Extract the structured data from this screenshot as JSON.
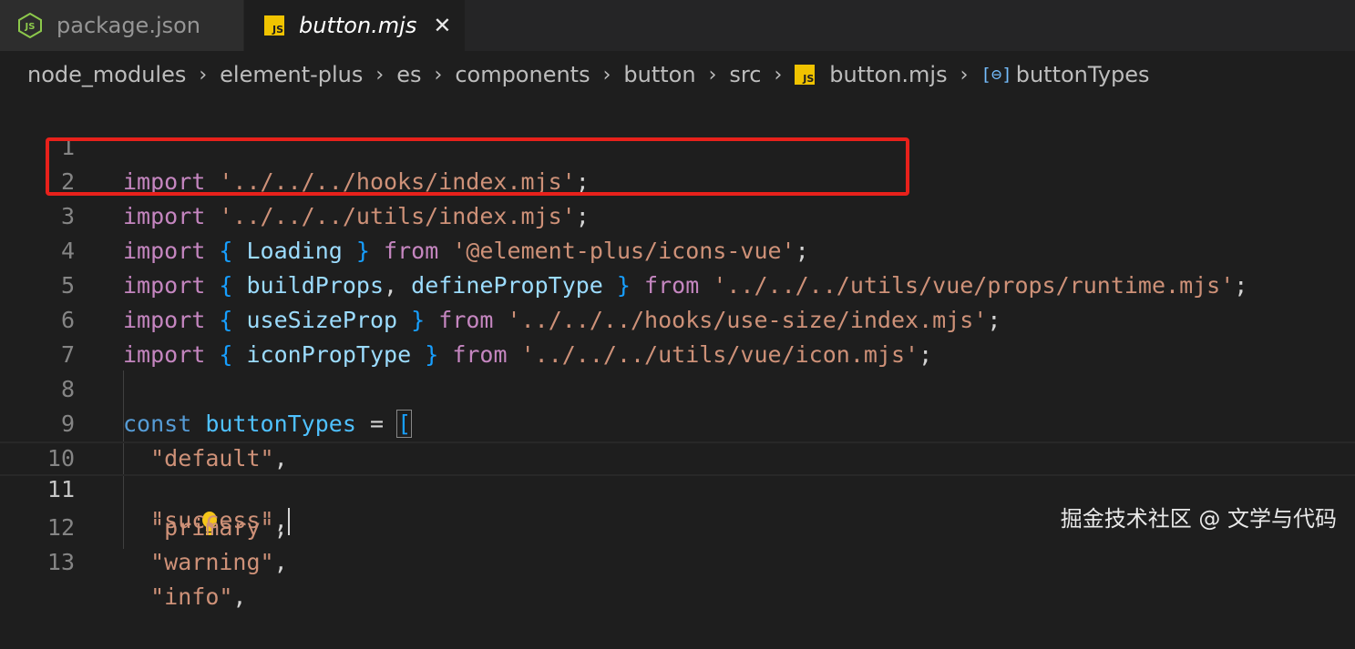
{
  "tabs": [
    {
      "label": "package.json",
      "icon": "nodejs-icon",
      "active": false
    },
    {
      "label": "button.mjs",
      "icon": "js-file-icon",
      "active": true
    }
  ],
  "tab_close": "✕",
  "js_badge": "JS",
  "breadcrumb": [
    "node_modules",
    "element-plus",
    "es",
    "components",
    "button",
    "src",
    "button.mjs",
    "buttonTypes"
  ],
  "breadcrumb_separator": "›",
  "line_numbers": [
    "1",
    "2",
    "3",
    "4",
    "5",
    "6",
    "7",
    "8",
    "9",
    "10",
    "11",
    "12",
    "13"
  ],
  "code": {
    "l1": {
      "kw": "import",
      "str": "'../../../hooks/index.mjs'",
      "semi": ";"
    },
    "l2": {
      "kw": "import",
      "str": "'../../../utils/index.mjs'",
      "semi": ";"
    },
    "l3": {
      "kw": "import",
      "open": "{",
      "ident": "Loading",
      "close": "}",
      "from": "from",
      "str": "'@element-plus/icons-vue'",
      "semi": ";"
    },
    "l4": {
      "kw": "import",
      "open": "{",
      "ident": "buildProps",
      "comma": ",",
      "ident2": "definePropType",
      "close": "}",
      "from": "from",
      "str": "'../../../utils/vue/props/runtime.mjs'",
      "semi": ";"
    },
    "l5": {
      "kw": "import",
      "open": "{",
      "ident": "useSizeProp",
      "close": "}",
      "from": "from",
      "str": "'../../../hooks/use-size/index.mjs'",
      "semi": ";"
    },
    "l6": {
      "kw": "import",
      "open": "{",
      "ident": "iconPropType",
      "close": "}",
      "from": "from",
      "str": "'../../../utils/vue/icon.mjs'",
      "semi": ";"
    },
    "l8": {
      "kw": "const",
      "ident": "buttonTypes",
      "eq": "=",
      "bracket": "["
    },
    "l9": {
      "str": "\"default\"",
      "comma": ","
    },
    "l10": {
      "str": "\"primary\"",
      "comma": ","
    },
    "l11": {
      "str": "\"success\"",
      "comma": ","
    },
    "l12": {
      "str": "\"warning\"",
      "comma": ","
    },
    "l13": {
      "str": "\"info\"",
      "comma": ","
    }
  },
  "current_line": 11,
  "watermark": "掘金技术社区 @ 文学与代码",
  "colors": {
    "keyword": "#c586c0",
    "storage": "#569cd6",
    "string": "#ce9178",
    "variable": "#9cdcfe",
    "highlight_box": "#e8211b"
  }
}
